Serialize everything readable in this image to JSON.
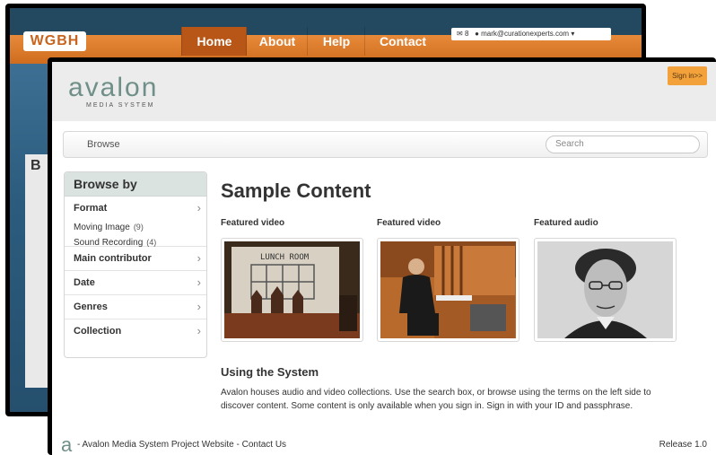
{
  "back_window": {
    "logo": "WGBH",
    "nav": [
      "Home",
      "About",
      "Help",
      "Contact"
    ],
    "notification_count": "8",
    "user_email": "mark@curationexperts.com",
    "partial_heading": "B"
  },
  "header": {
    "logo_text": "avalon",
    "logo_subtext": "MEDIA SYSTEM",
    "signin_label": "Sign in>>"
  },
  "navbar": {
    "browse_label": "Browse",
    "search_placeholder": "Search"
  },
  "sidebar": {
    "title": "Browse by",
    "facets": [
      {
        "label": "Format",
        "items": [
          {
            "label": "Moving Image",
            "count": "(9)"
          },
          {
            "label": "Sound Recording",
            "count": "(4)"
          }
        ]
      },
      {
        "label": "Main contributor"
      },
      {
        "label": "Date"
      },
      {
        "label": "Genres"
      },
      {
        "label": "Collection"
      }
    ]
  },
  "main": {
    "title": "Sample Content",
    "featured": [
      {
        "label": "Featured video",
        "image": "lunch-room-video-thumbnail",
        "caption_text": "LUNCH ROOM"
      },
      {
        "label": "Featured video",
        "image": "organist-video-thumbnail"
      },
      {
        "label": "Featured audio",
        "image": "composer-portrait-thumbnail"
      }
    ],
    "section_title": "Using the System",
    "section_text": "Avalon houses audio and video collections. Use the search box, or browse using the terms on the left side to discover content. Some content is only available when you sign in. Sign in with your ID and passphrase."
  },
  "footer": {
    "logo": "a",
    "text": "- Avalon Media System Project Website - Contact Us",
    "release": "Release 1.0"
  },
  "colors": {
    "accent_orange": "#f2a13b",
    "wgbh_orange": "#d9782a",
    "logo_green": "#6f8f88"
  }
}
